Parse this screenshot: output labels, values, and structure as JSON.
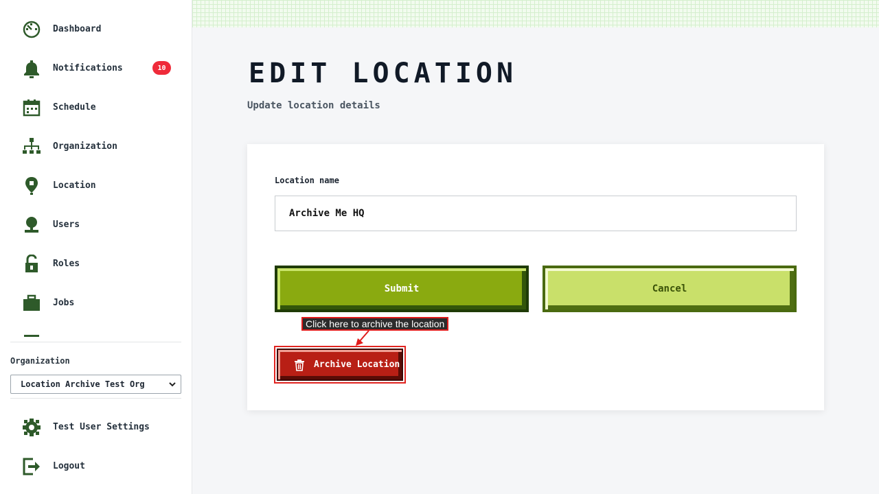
{
  "sidebar": {
    "items": [
      {
        "label": "Dashboard",
        "icon": "dashboard-icon"
      },
      {
        "label": "Notifications",
        "icon": "bell-icon",
        "badge": "10"
      },
      {
        "label": "Schedule",
        "icon": "calendar-icon"
      },
      {
        "label": "Organization",
        "icon": "org-chart-icon"
      },
      {
        "label": "Location",
        "icon": "location-pin-icon"
      },
      {
        "label": "Users",
        "icon": "user-icon"
      },
      {
        "label": "Roles",
        "icon": "unlock-icon"
      },
      {
        "label": "Jobs",
        "icon": "briefcase-icon"
      }
    ],
    "organization_label": "Organization",
    "organization_selected": "Location Archive Test Org",
    "settings_label": "Test User Settings",
    "logout_label": "Logout"
  },
  "page": {
    "title": "EDIT LOCATION",
    "subtitle": "Update location details"
  },
  "form": {
    "location_name_label": "Location name",
    "location_name_value": "Archive Me HQ",
    "submit_label": "Submit",
    "cancel_label": "Cancel",
    "archive_label": "Archive Location",
    "tooltip": "Click here to archive the location"
  },
  "colors": {
    "accent_green": "#8aaa10",
    "light_green": "#c9e06a",
    "danger_red": "#b81f15",
    "badge_red": "#ef2b3a",
    "icon_green": "#2e5a2a"
  }
}
